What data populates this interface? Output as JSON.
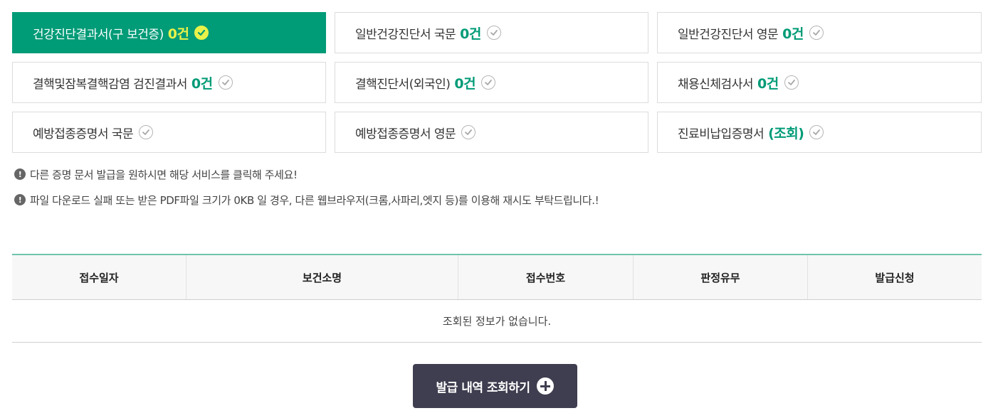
{
  "tabs": [
    {
      "label": "건강진단결과서(구 보건증)",
      "count": "0건",
      "active": true
    },
    {
      "label": "일반건강진단서 국문",
      "count": "0건"
    },
    {
      "label": "일반건강진단서 영문",
      "count": "0건"
    },
    {
      "label": "결핵및잠복결핵감염 검진결과서",
      "count": "0건"
    },
    {
      "label": "결핵진단서(외국인)",
      "count": "0건"
    },
    {
      "label": "채용신체검사서",
      "count": "0건"
    },
    {
      "label": "예방접종증명서 국문",
      "count": ""
    },
    {
      "label": "예방접종증명서 영문",
      "count": ""
    },
    {
      "label": "진료비납입증명서",
      "count": "(조회)"
    }
  ],
  "notices": [
    "다른 증명 문서 발급을 원하시면 해당 서비스를 클릭해 주세요!",
    "파일 다운로드 실패 또는 받은 PDF파일 크기가 0KB 일 경우, 다른 웹브라우저(크롬,사파리,엣지 등)를 이용해 재시도 부탁드립니다.!"
  ],
  "notice_icon": "exclamation-circle-icon",
  "table": {
    "headers": [
      "접수일자",
      "보건소명",
      "접수번호",
      "판정유무",
      "발급신청"
    ],
    "empty_message": "조회된 정보가 없습니다."
  },
  "history_button": {
    "label": "발급 내역 조회하기",
    "icon": "plus-circle-icon"
  },
  "colors": {
    "accent": "#009b77",
    "active_highlight": "#e9f24a",
    "button_dark": "#3f3e50",
    "table_top_border": "#6fc4ad"
  }
}
